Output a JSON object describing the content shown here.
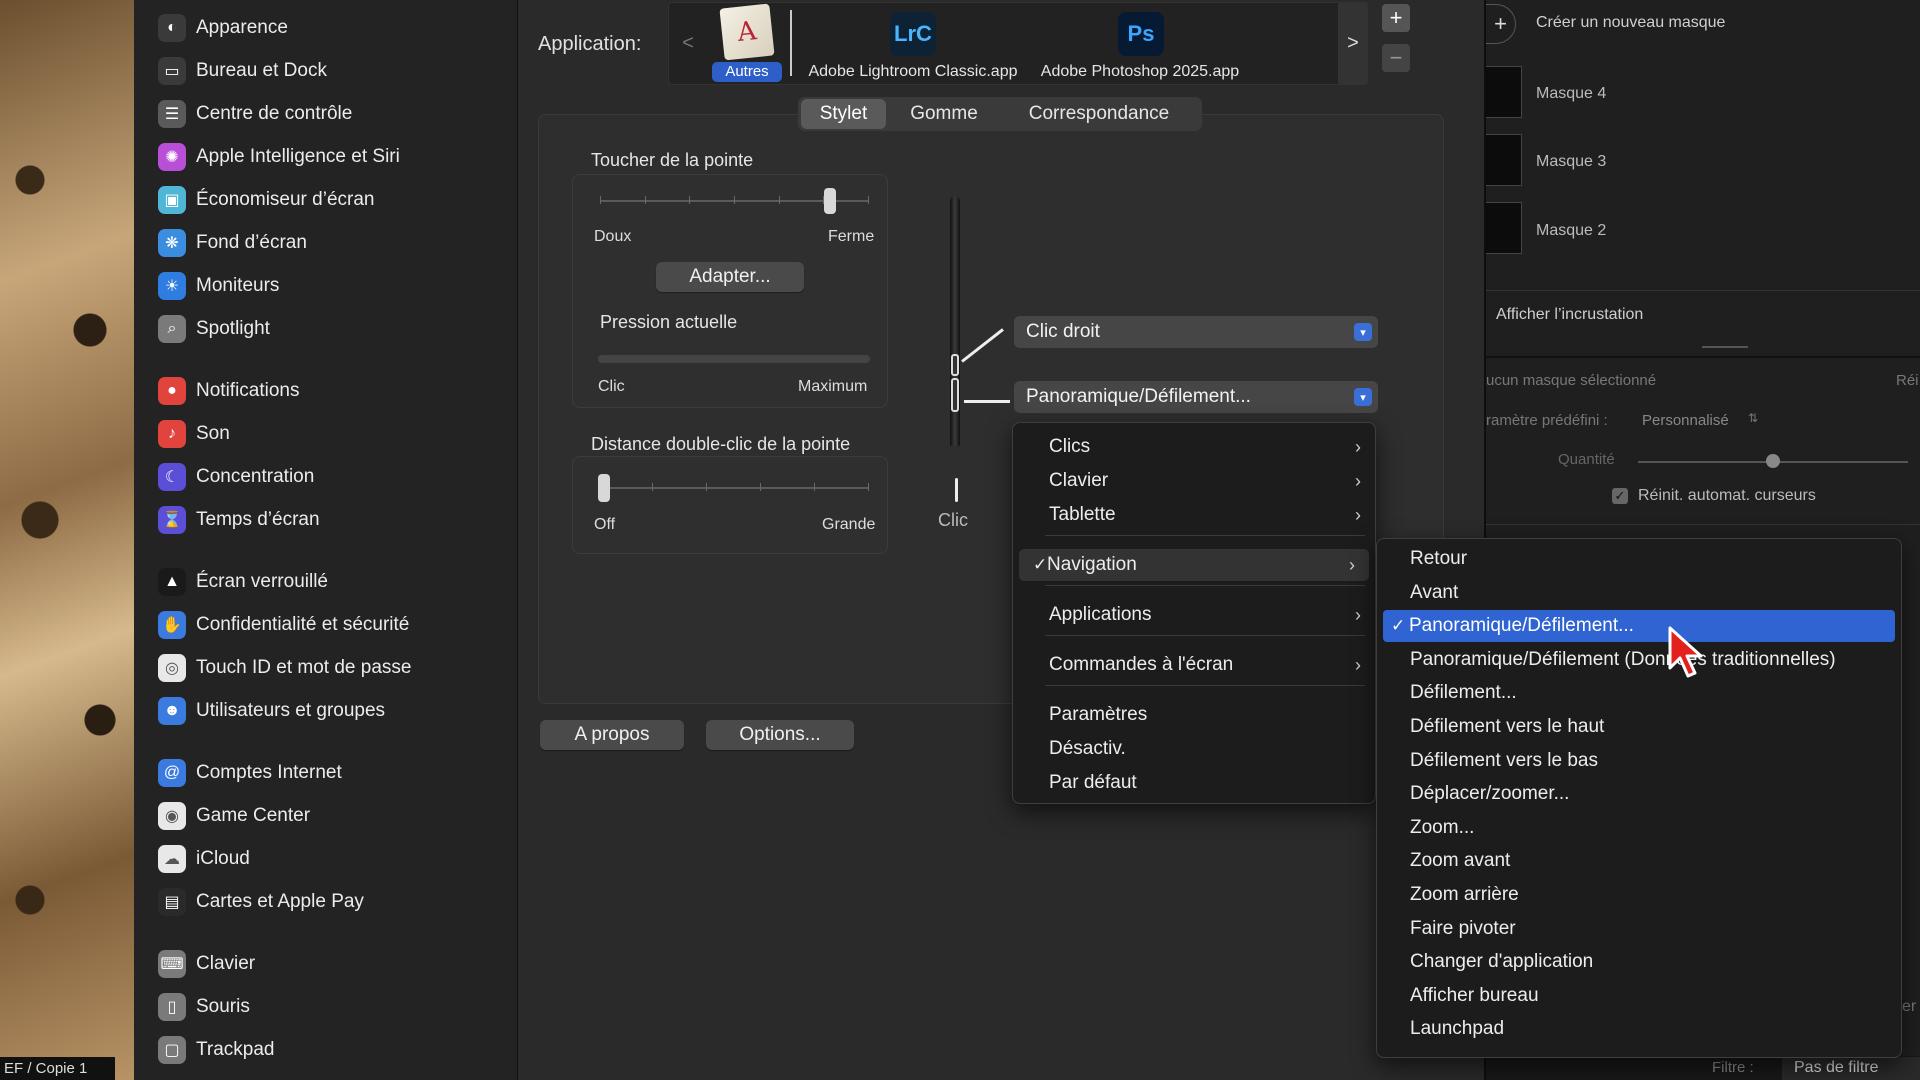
{
  "background": {
    "copy_label": "EF / Copie 1"
  },
  "sidebar": {
    "items": [
      {
        "label": "Apparence",
        "icon": "appearance-icon",
        "color": "#3a3a3a"
      },
      {
        "label": "Bureau et Dock",
        "icon": "dock-icon",
        "color": "#3a3a3a"
      },
      {
        "label": "Centre de contrôle",
        "icon": "control-center-icon",
        "color": "#5a5a5a"
      },
      {
        "label": "Apple Intelligence et Siri",
        "icon": "siri-icon",
        "color": "#b84fd6"
      },
      {
        "label": "Économiseur d’écran",
        "icon": "screensaver-icon",
        "color": "#4fb6d8"
      },
      {
        "label": "Fond d’écran",
        "icon": "wallpaper-icon",
        "color": "#3b8de0"
      },
      {
        "label": "Moniteurs",
        "icon": "displays-icon",
        "color": "#2f7de1"
      },
      {
        "label": "Spotlight",
        "icon": "spotlight-icon",
        "color": "#7a7a7a"
      },
      {
        "label": "Notifications",
        "icon": "notifications-icon",
        "color": "#e0443c"
      },
      {
        "label": "Son",
        "icon": "sound-icon",
        "color": "#e0443c"
      },
      {
        "label": "Concentration",
        "icon": "focus-icon",
        "color": "#5a4fd6"
      },
      {
        "label": "Temps d’écran",
        "icon": "screen-time-icon",
        "color": "#5a4fd6"
      },
      {
        "label": "Écran verrouillé",
        "icon": "lock-screen-icon",
        "color": "#1a1a1a"
      },
      {
        "label": "Confidentialité et sécurité",
        "icon": "privacy-hand-icon",
        "color": "#3b7be0"
      },
      {
        "label": "Touch ID et mot de passe",
        "icon": "fingerprint-icon",
        "color": "#e8e8e8"
      },
      {
        "label": "Utilisateurs et groupes",
        "icon": "users-icon",
        "color": "#3b7be0"
      },
      {
        "label": "Comptes Internet",
        "icon": "at-icon",
        "color": "#3b7be0"
      },
      {
        "label": "Game Center",
        "icon": "game-center-icon",
        "color": "#e8e8e8"
      },
      {
        "label": "iCloud",
        "icon": "cloud-icon",
        "color": "#e8e8e8"
      },
      {
        "label": "Cartes et Apple Pay",
        "icon": "wallet-icon",
        "color": "#2a2a2a"
      },
      {
        "label": "Clavier",
        "icon": "keyboard-icon",
        "color": "#7a7a7a"
      },
      {
        "label": "Souris",
        "icon": "mouse-icon",
        "color": "#7a7a7a"
      },
      {
        "label": "Trackpad",
        "icon": "trackpad-icon",
        "color": "#7a7a7a"
      }
    ]
  },
  "main": {
    "application_label": "Application:",
    "apps": [
      {
        "label": "Autres",
        "selected": true,
        "icon": "other-apps-icon"
      },
      {
        "label": "Adobe Lightroom Classic.app",
        "badge": "LrC",
        "icon": "lightroom-icon"
      },
      {
        "label": "Adobe Photoshop 2025.app",
        "badge": "Ps",
        "icon": "photoshop-icon"
      }
    ],
    "prev_label": "<",
    "next_label": ">",
    "add_label": "+",
    "remove_label": "−",
    "tabs": [
      {
        "label": "Stylet",
        "selected": true
      },
      {
        "label": "Gomme",
        "selected": false
      },
      {
        "label": "Correspondance",
        "selected": false
      }
    ],
    "tip_feel": {
      "title": "Toucher de la pointe",
      "min": "Doux",
      "max": "Ferme",
      "level": 0.86,
      "adapt_button": "Adapter...",
      "pressure_title": "Pression actuelle",
      "pressure_min": "Clic",
      "pressure_max": "Maximum",
      "pressure": 0.0
    },
    "double_click": {
      "title": "Distance double-clic de la pointe",
      "min": "Off",
      "max": "Grande",
      "level": 0.0
    },
    "pen_tip_label": "Clic",
    "upper_button_popup": "Clic droit",
    "lower_button_popup": "Panoramique/Défilement...",
    "about_button": "A propos",
    "options_button": "Options..."
  },
  "menu": {
    "items": [
      {
        "label": "Clics",
        "submenu": true
      },
      {
        "label": "Clavier",
        "submenu": true
      },
      {
        "label": "Tablette",
        "submenu": true
      },
      {
        "label": "Navigation",
        "submenu": true,
        "checked": true
      },
      {
        "label": "Applications",
        "submenu": true
      },
      {
        "label": "Commandes à l'écran",
        "submenu": true
      },
      {
        "label": "Paramètres"
      },
      {
        "label": "Désactiv."
      },
      {
        "label": "Par défaut"
      }
    ],
    "check": "✓",
    "chevron": "›"
  },
  "submenu": {
    "items": [
      {
        "label": "Retour"
      },
      {
        "label": "Avant"
      },
      {
        "label": "Panoramique/Défilement...",
        "checked": true,
        "highlighted": true
      },
      {
        "label": "Panoramique/Défilement (Données traditionnelles)"
      },
      {
        "label": "Défilement..."
      },
      {
        "label": "Défilement vers le haut"
      },
      {
        "label": "Défilement vers le bas"
      },
      {
        "label": "Déplacer/zoomer..."
      },
      {
        "label": "Zoom..."
      },
      {
        "label": "Zoom avant"
      },
      {
        "label": "Zoom arrière"
      },
      {
        "label": "Faire pivoter"
      },
      {
        "label": "Changer d'application"
      },
      {
        "label": "Afficher bureau"
      },
      {
        "label": "Launchpad"
      }
    ],
    "highlight_color": "#2f64d2"
  },
  "lightroom": {
    "create_mask": "Créer un nouveau masque",
    "masks": [
      "Masque 4",
      "Masque 3",
      "Masque 2"
    ],
    "overlay_label": "Afficher l’incrustation",
    "no_mask": "ucun masque sélectionné",
    "reset_partial": "Réi",
    "preset_label": "ramètre prédéfini :",
    "preset_value": "Personnalisé",
    "amount_label": "Quantité",
    "amount": 0.5,
    "auto_reset": "Réinit. automat. curseurs",
    "filter_label": "Filtre :",
    "filter_value": "Pas de filtre",
    "edge_partial": "er"
  }
}
